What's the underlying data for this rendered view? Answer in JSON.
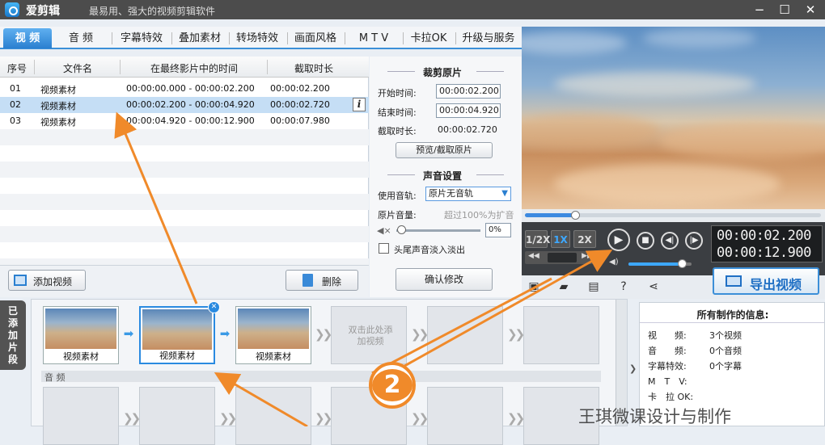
{
  "app": {
    "name": "爱剪辑",
    "slogan": "最易用、强大的视频剪辑软件",
    "min": "−",
    "max": "☐",
    "close": "✕"
  },
  "tabs": [
    {
      "label": "视 频"
    },
    {
      "label": "音 频"
    },
    {
      "label": "字幕特效"
    },
    {
      "label": "叠加素材"
    },
    {
      "label": "转场特效"
    },
    {
      "label": "画面风格"
    },
    {
      "label": "M T V"
    },
    {
      "label": "卡拉OK"
    },
    {
      "label": "升级与服务"
    }
  ],
  "table": {
    "headers": [
      "序号",
      "文件名",
      "在最终影片中的时间",
      "截取时长"
    ],
    "rows": [
      {
        "index": "01",
        "name": "视频素材",
        "span": "00:00:00.000 - 00:00:02.200",
        "duration": "00:00:02.200"
      },
      {
        "index": "02",
        "name": "视频素材",
        "span": "00:00:02.200 - 00:00:04.920",
        "duration": "00:00:02.720"
      },
      {
        "index": "03",
        "name": "视频素材",
        "span": "00:00:04.920 - 00:00:12.900",
        "duration": "00:00:07.980"
      }
    ],
    "info": "i"
  },
  "list_actions": {
    "add": "添加视频",
    "delete": "删除"
  },
  "crop": {
    "title": "裁剪原片",
    "start_label": "开始时间:",
    "start_value": "00:00:02.200",
    "end_label": "结束时间:",
    "end_value": "00:00:04.920",
    "duration_label": "截取时长:",
    "duration_value": "00:00:02.720",
    "preview_button": "预览/截取原片"
  },
  "sound": {
    "title": "声音设置",
    "track_label": "使用音轨:",
    "track_value": "原片无音轨",
    "volume_label": "原片音量:",
    "volume_hint": "超过100%为扩音",
    "volume_value": "0%",
    "fade_label": "头尾声音淡入淡出",
    "confirm": "确认修改"
  },
  "player": {
    "progress": 0.17,
    "speeds": [
      "1/2X",
      "1X",
      "2X"
    ],
    "current_time": "00:00:02.200",
    "total_time": "00:00:12.900",
    "volume": 0.85,
    "export": "导出视频"
  },
  "strip": {
    "tab_label": "已添加片段",
    "clips": [
      {
        "name": "视频素材"
      },
      {
        "name": "视频素材"
      },
      {
        "name": "视频素材"
      }
    ],
    "add_hint": "双击此处添加视频",
    "audio_label": "音 频"
  },
  "summary": {
    "title": "所有制作的信息:",
    "items": [
      {
        "k": "视　　频:",
        "v": "3个视频"
      },
      {
        "k": "音　　频:",
        "v": "0个音频"
      },
      {
        "k": "字幕特效:",
        "v": "0个字幕"
      },
      {
        "k": "M　T　V:",
        "v": ""
      },
      {
        "k": "卡　拉 OK:",
        "v": ""
      }
    ]
  },
  "annotation": {
    "badge": "2",
    "watermark": "王琪微课设计与制作"
  },
  "colors": {
    "accent": "#2a7fd0",
    "arrow": "#f08a2a"
  }
}
